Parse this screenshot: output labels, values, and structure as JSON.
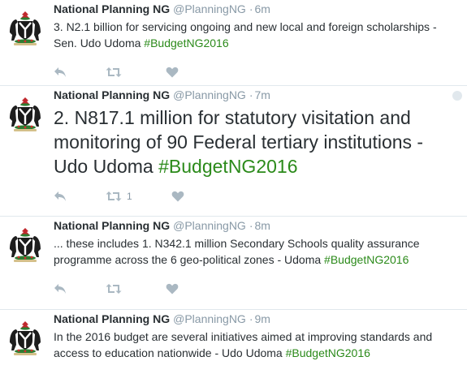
{
  "tweets": [
    {
      "name": "National Planning NG",
      "handle": "@PlanningNG",
      "separator": "·",
      "time": "6m",
      "text": "3. N2.1 billion for servicing ongoing and new local and foreign scholarships - Sen.  Udo Udoma ",
      "hashtag": "#BudgetNG2016",
      "retweets": ""
    },
    {
      "name": "National Planning NG",
      "handle": "@PlanningNG",
      "separator": "·",
      "time": "7m",
      "text": "2. N817.1 million for statutory visitation and monitoring of 90 Federal tertiary institutions - Udo Udoma ",
      "hashtag": "#BudgetNG2016",
      "retweets": "1"
    },
    {
      "name": "National Planning NG",
      "handle": "@PlanningNG",
      "separator": "·",
      "time": "8m",
      "text": "... these includes 1. N342.1 million Secondary Schools quality assurance programme across the 6 geo-political zones - Udoma ",
      "hashtag": "#BudgetNG2016",
      "retweets": ""
    },
    {
      "name": "National Planning NG",
      "handle": "@PlanningNG",
      "separator": "·",
      "time": "9m",
      "text": "In the 2016 budget are several initiatives aimed at improving standards and access to education nationwide - Udo Udoma ",
      "hashtag": "#BudgetNG2016",
      "retweets": ""
    }
  ],
  "icons": {
    "reply": "reply-icon",
    "retweet": "retweet-icon",
    "like": "heart-icon",
    "avatar": "nigeria-coat-of-arms",
    "more": "caret-icon"
  },
  "colors": {
    "hashtag": "#2b8a1a",
    "meta": "#8899a6",
    "icon": "#aab8c2",
    "text": "#292f33",
    "divider": "#e1e8ed"
  }
}
